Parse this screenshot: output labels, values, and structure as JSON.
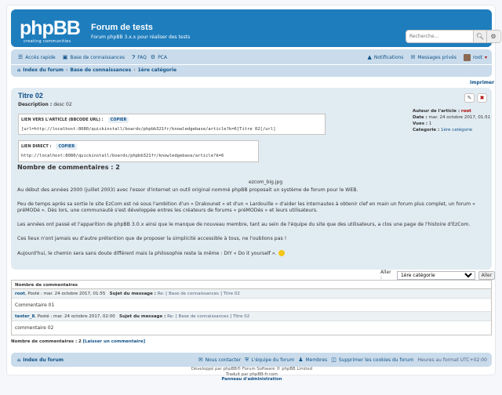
{
  "header": {
    "logo_text": "phpBB",
    "logo_sub": "creating communities",
    "site_title": "Forum de tests",
    "site_description": "Forum phpBB 3.x.x pour réaliser des tests",
    "search_placeholder": "Recherche…"
  },
  "nav": {
    "quick_access": "Accès rapide",
    "knowledge_base": "Base de connaissances",
    "faq": "FAQ",
    "pca": "PCA",
    "notifications": "Notifications",
    "private_messages": "Messages privés",
    "user": "root",
    "breadcrumbs": [
      "Index du forum",
      "Base de connaissances",
      "1ère catégorie"
    ]
  },
  "print_label": "Imprimer",
  "article": {
    "title": "Titre 02",
    "desc_label": "Description :",
    "desc_value": "desc 02",
    "bbcode_label": "LIEN VERS L'ARTICLE (BBCODE URL) :",
    "copy_label": "COPIER",
    "bbcode_value": "[url=http://localhost:8080/quickinstall/boards/phpbb321fr/knowledgebase/article?k=6]Titre 02[/url]",
    "direct_label": "LIEN DIRECT :",
    "direct_value": "http://localhost:8080/quickinstall/boards/phpbb321fr/knowledgebase/article?k=6",
    "meta": {
      "author_label": "Auteur de l'article :",
      "author": "root",
      "date_label": "Date :",
      "date": "mar. 24 octobre 2017, 01:51",
      "views_label": "Vues :",
      "views": "1",
      "category_label": "Categorie :",
      "category": "1ère catégorie"
    },
    "comments_count_title": "Nombre de commentaires : 2",
    "image_caption": "ezcom_big.jpg",
    "paragraphs": [
      "Au début des années 2000 (juillet 2003) avec l'essor d'internet un outil original nommé phpBB proposait un système de forum pour le WEB.",
      "Peu de temps après sa sortie le site EzCom est né sous l'ambition d'un « Drakounet » et d'un « Lardouille » d'aider les internautes à obtenir clef en main un forum plus complet, un forum « préMODé ». Dès lors, une communauté s'est développée entres les créateurs de forums « préMODés » et leurs utilisateurs.",
      "Les années ont passé et l'apparition de phpBB 3.0.x ainsi que le manque de nouveau membre, tant au sein de l'équipe du site que des utilisateurs, a clos une page de l'histoire d'EzCom.",
      "Ces lieux n'ont jamais eu d'autre prétention que de proposer la simplicité accessible à tous, ne l'oublions pas !",
      "Aujourd'hui, le chemin sera sans doute différent mais la philosophie reste la même : DIY « Do it yourself »."
    ]
  },
  "jump": {
    "label": "Aller :",
    "selected": "1ère catégorie",
    "button": "Aller"
  },
  "comments": {
    "header": "Nombre de commentaires",
    "items": [
      {
        "author": "root",
        "posted": ", Posté : mar. 24 octobre 2017, 01:55",
        "subject_label": "Sujet du message :",
        "subject": "Re: [ Base de connaissances ] Titre 02",
        "body": "Commentaire 01"
      },
      {
        "author": "tester_8",
        "posted": ", Posté : mar. 24 octobre 2017, 02:00",
        "subject_label": "Sujet du message :",
        "subject": "Re: [ Base de connaissances ] Titre 02",
        "body": "commentaire 02"
      }
    ],
    "count_label": "Nombre de commentaires :",
    "count_value": "2",
    "add_link": "[Laisser un commentaire]"
  },
  "footer": {
    "index": "Index du forum",
    "contact": "Nous contacter",
    "team": "L'équipe du forum",
    "members": "Membres",
    "delete_cookies": "Supprimer les cookies du forum",
    "timezone": "Heures au format UTC+02:00",
    "credit1": "Développé par phpBB® Forum Software © phpBB Limited",
    "credit2": "Traduit par phpBB-fr.com",
    "admin": "Panneau d'administration"
  }
}
